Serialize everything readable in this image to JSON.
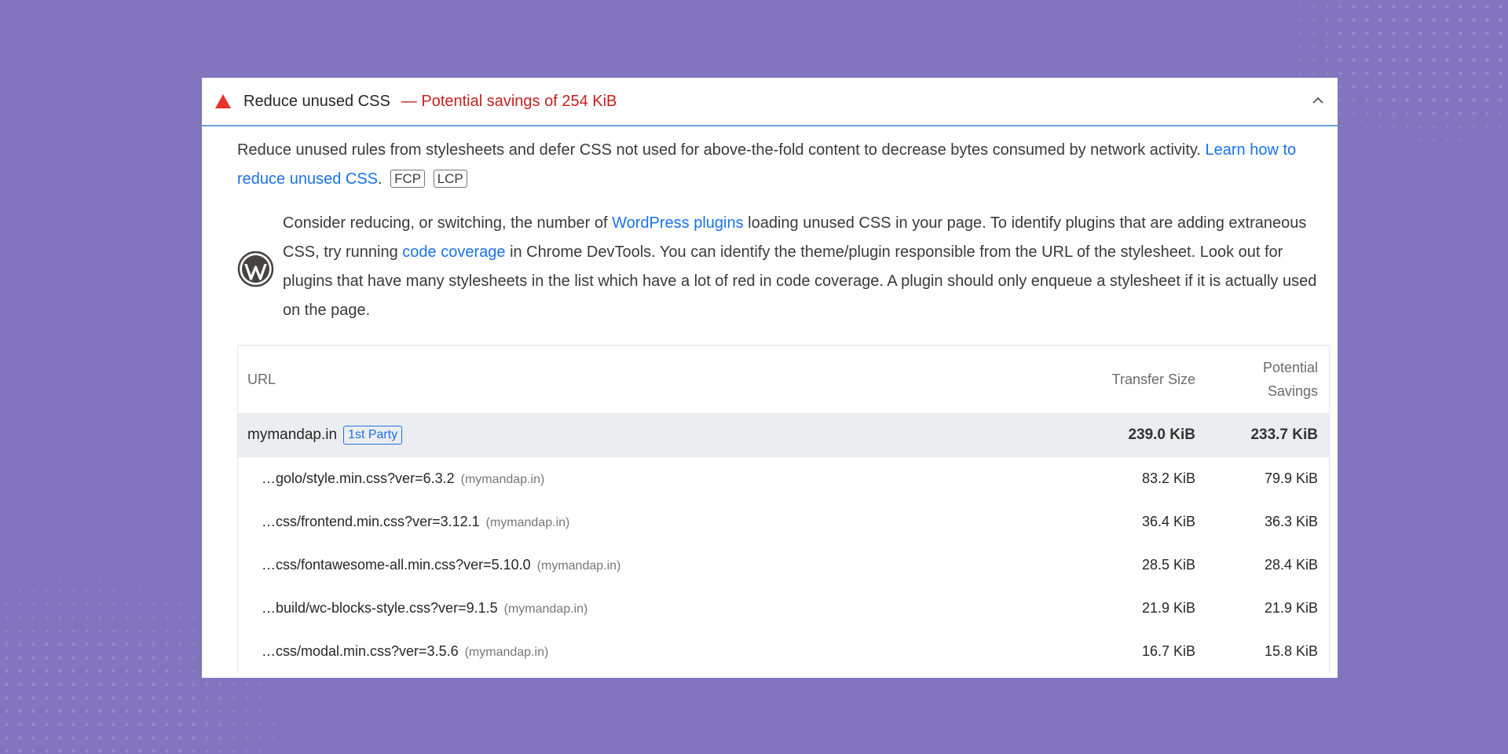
{
  "audit": {
    "title": "Reduce unused CSS",
    "savings": "— Potential savings of 254 KiB",
    "status_color": "#c5221f",
    "icons": {
      "status": "warning-triangle-icon",
      "collapse": "chevron-up-icon",
      "stack": "wordpress-icon"
    }
  },
  "description": {
    "text": "Reduce unused rules from stylesheets and defer CSS not used for above-the-fold content to decrease bytes consumed by network activity.",
    "link": "Learn how to reduce unused CSS",
    "after_link": ".",
    "badges": [
      "FCP",
      "LCP"
    ]
  },
  "stack_pack": {
    "p1": "Consider reducing, or switching, the number of",
    "link1": "WordPress plugins",
    "p2": "loading unused CSS in your page. To identify plugins that are adding extraneous CSS, try running",
    "link2": "code coverage",
    "p3": "in Chrome DevTools. You can identify the theme/plugin responsible from the URL of the stylesheet. Look out for plugins that have many stylesheets in the list which have a lot of red in code coverage. A plugin should only enqueue a stylesheet if it is actually used on the page."
  },
  "table": {
    "headers": {
      "url": "URL",
      "size": "Transfer Size",
      "savings_line1": "Potential",
      "savings_line2": "Savings"
    },
    "group": {
      "name": "mymandap.in",
      "badge": "1st Party",
      "size": "239.0 KiB",
      "savings": "233.7 KiB"
    },
    "rows": [
      {
        "url": "…golo/style.min.css?ver=6.3.2",
        "host": "(mymandap.in)",
        "size": "83.2 KiB",
        "savings": "79.9 KiB"
      },
      {
        "url": "…css/frontend.min.css?ver=3.12.1",
        "host": "(mymandap.in)",
        "size": "36.4 KiB",
        "savings": "36.3 KiB"
      },
      {
        "url": "…css/fontawesome-all.min.css?ver=5.10.0",
        "host": "(mymandap.in)",
        "size": "28.5 KiB",
        "savings": "28.4 KiB"
      },
      {
        "url": "…build/wc-blocks-style.css?ver=9.1.5",
        "host": "(mymandap.in)",
        "size": "21.9 KiB",
        "savings": "21.9 KiB"
      },
      {
        "url": "…css/modal.min.css?ver=3.5.6",
        "host": "(mymandap.in)",
        "size": "16.7 KiB",
        "savings": "15.8 KiB"
      }
    ]
  }
}
